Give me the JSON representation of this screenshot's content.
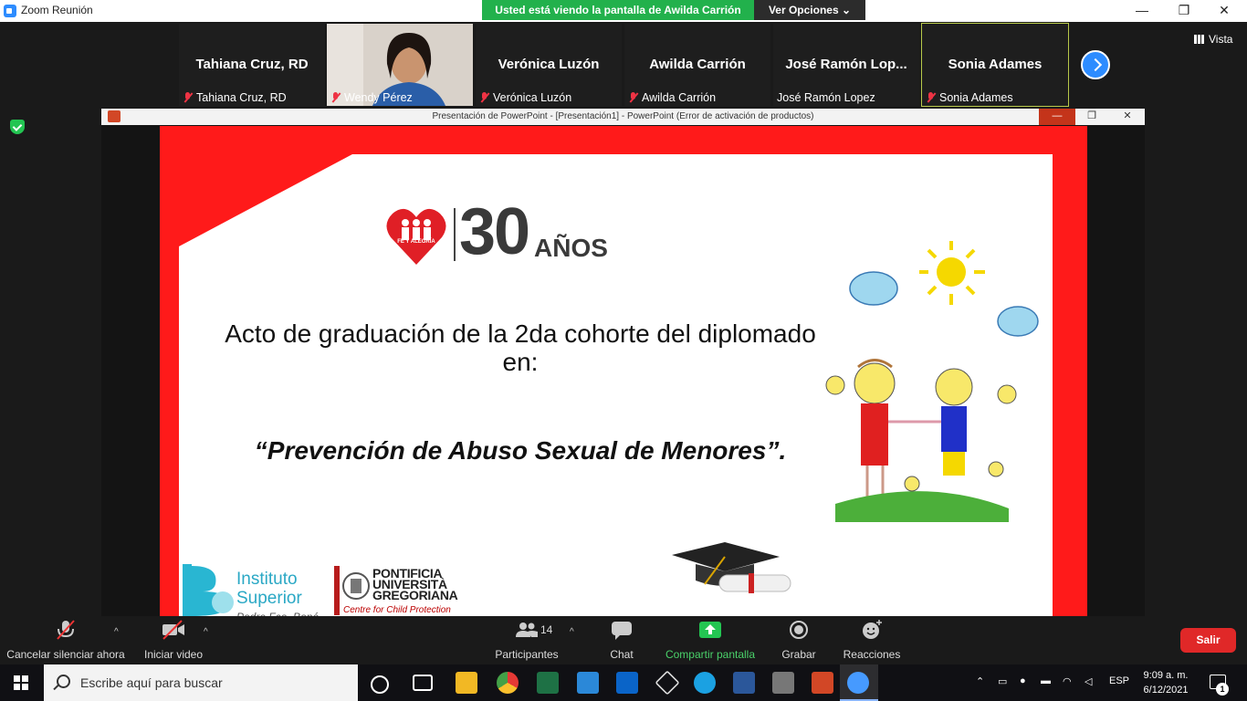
{
  "window": {
    "title": "Zoom Reunión",
    "share_banner": "Usted está viendo la pantalla de Awilda Carrión",
    "view_options": "Ver Opciones",
    "min": "—",
    "restore": "❐",
    "close": "✕"
  },
  "gallery": {
    "view_label": "Vista",
    "participants": [
      {
        "name": "Tahiana Cruz, RD",
        "label": "Tahiana Cruz, RD",
        "muted": true,
        "video": false
      },
      {
        "name": "",
        "label": "Wendy Pérez",
        "muted": true,
        "video": true
      },
      {
        "name": "Verónica Luzón",
        "label": "Verónica Luzón",
        "muted": true,
        "video": false
      },
      {
        "name": "Awilda Carrión",
        "label": "Awilda Carrión",
        "muted": true,
        "video": false
      },
      {
        "name": "José Ramón Lop...",
        "label": "José Ramón Lopez",
        "muted": false,
        "video": false
      },
      {
        "name": "Sonia Adames",
        "label": "Sonia Adames",
        "muted": true,
        "video": false
      }
    ]
  },
  "ppt": {
    "window_title": "Presentación de PowerPoint - [Presentación1] - PowerPoint (Error de activación de productos)",
    "min": "—",
    "restore": "❐",
    "close": "✕"
  },
  "slide": {
    "logo_number": "30",
    "logo_suffix": "AÑOS",
    "logo_brand": "FE Y ALEGRÍA",
    "title": "Acto de graduación de la 2da cohorte del diplomado en:",
    "subtitle": "“Prevención de Abuso Sexual de Menores”.",
    "inst_line1": "Instituto",
    "inst_line2": "Superior",
    "inst_line3": "Pedro Fco. Bonó",
    "pug_line1": "PONTIFICIA",
    "pug_line2": "UNIVERSITÀ",
    "pug_line3": "GREGORIANA",
    "pug_sub": "Centre for Child Protection"
  },
  "toolbar": {
    "unmute": "Cancelar silenciar ahora",
    "start_video": "Iniciar video",
    "participants": "Participantes",
    "participants_count": "14",
    "chat": "Chat",
    "share": "Compartir pantalla",
    "record": "Grabar",
    "reactions": "Reacciones",
    "exit": "Salir",
    "caret": "^"
  },
  "taskbar": {
    "search_placeholder": "Escribe aquí para buscar",
    "lang": "ESP",
    "time": "9:09 a. m.",
    "date": "6/12/2021",
    "notifications": "1"
  },
  "colors": {
    "zoom_blue": "#2d8cff",
    "share_green": "#22b14c",
    "exit_red": "#e02828",
    "slide_red": "#ff1a1a"
  }
}
